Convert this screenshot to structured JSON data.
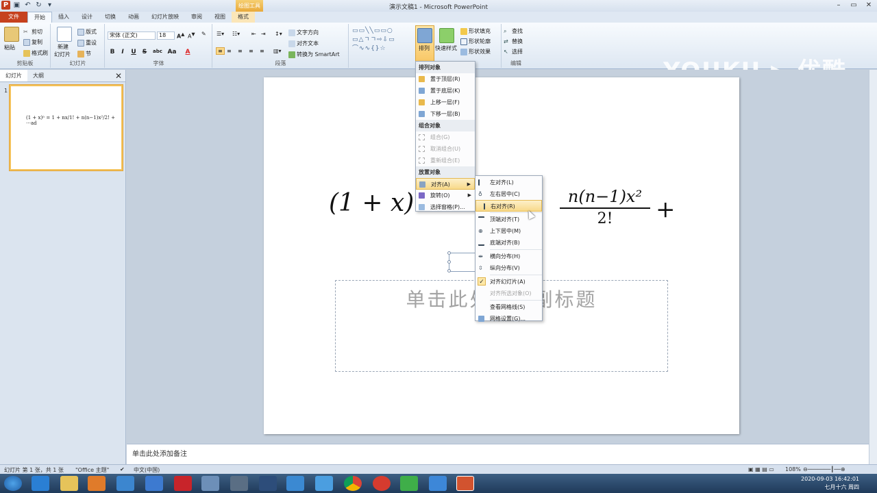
{
  "window": {
    "title": "演示文稿1 - Microsoft PowerPoint",
    "tool_context": "绘图工具"
  },
  "tabs": [
    "文件",
    "开始",
    "插入",
    "设计",
    "切换",
    "动画",
    "幻灯片放映",
    "审阅",
    "视图",
    "格式"
  ],
  "ribbon": {
    "clipboard": {
      "paste": "粘贴",
      "cut": "剪切",
      "copy": "复制",
      "format_painter": "格式刷",
      "label": "剪贴板"
    },
    "slides": {
      "new_slide": "新建",
      "new_slide2": "幻灯片",
      "layout": "版式",
      "reset": "重设",
      "section": "节",
      "label": "幻灯片"
    },
    "font": {
      "name": "宋体 (正文)",
      "size": "18",
      "label": "字体",
      "bold": "B",
      "italic": "I",
      "underline": "U",
      "strike": "S",
      "abc": "abc",
      "aa": "Aa",
      "a": "A"
    },
    "paragraph": {
      "text_direction": "文字方向",
      "align_text": "对齐文本",
      "smartart": "转换为 SmartArt",
      "label": "段落"
    },
    "drawing": {
      "arrange": "排列",
      "quick_styles": "快速样式",
      "shape_fill": "形状填充",
      "shape_outline": "形状轮廓",
      "shape_effects": "形状效果"
    },
    "editing": {
      "find": "查找",
      "replace": "替换",
      "select": "选择",
      "label": "编辑"
    }
  },
  "watermark": {
    "brand": "YOUKU",
    "brand_cn": "优酷"
  },
  "left_panel": {
    "tab_slides": "幻灯片",
    "tab_outline": "大纲",
    "slide_number": "1"
  },
  "slide": {
    "formula_left": "(1 + x)ⁿ = 1 +",
    "frac_num": "n(n−1)x²",
    "frac_den": "2!",
    "plus": "+",
    "subtitle_placeholder": "单击此处添加副标题",
    "thumb_text": "(1 + x)ⁿ = 1 + nx/1! + n(n−1)x²/2! + ⋯ad"
  },
  "notes": {
    "placeholder": "单击此处添加备注"
  },
  "arrange_menu": {
    "head_order": "排列对象",
    "bring_to_front": "置于顶层(R)",
    "send_to_back": "置于底层(K)",
    "bring_forward": "上移一层(F)",
    "send_backward": "下移一层(B)",
    "head_group": "组合对象",
    "group": "组合(G)",
    "ungroup": "取消组合(U)",
    "regroup": "重新组合(E)",
    "head_position": "放置对象",
    "align": "对齐(A)",
    "rotate": "旋转(O)",
    "selection_pane": "选择窗格(P)..."
  },
  "align_menu": {
    "align_left": "左对齐(L)",
    "align_center": "左右居中(C)",
    "align_right": "右对齐(R)",
    "align_top": "顶端对齐(T)",
    "align_middle": "上下居中(M)",
    "align_bottom": "底端对齐(B)",
    "distribute_h": "横向分布(H)",
    "distribute_v": "纵向分布(V)",
    "align_to_slide": "对齐幻灯片(A)",
    "align_selected": "对齐所选对象(O)",
    "view_gridlines": "查看网格线(S)",
    "grid_settings": "网格设置(G)..."
  },
  "statusbar": {
    "slide_info": "幻灯片 第 1 张，共 1 张",
    "theme": "\"Office 主题\"",
    "language": "中文(中国)",
    "zoom": "108%"
  },
  "taskbar": {
    "time": "2020-09-03 16:42:01",
    "date": "七月十六 周四"
  },
  "colors": {
    "accent_file_tab": "#c6411e",
    "highlight": "#f8d98a",
    "ribbon_bg": "#dde7f2"
  }
}
